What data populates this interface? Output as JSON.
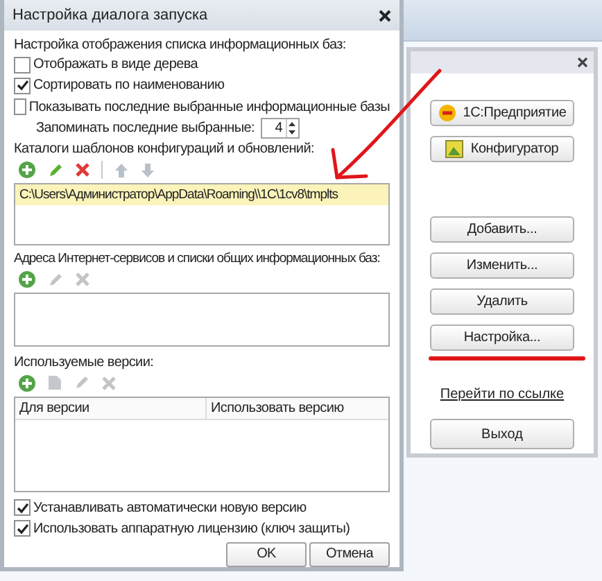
{
  "dialog": {
    "title": "Настройка диалога запуска",
    "display_heading": "Настройка отображения списка информационных баз:",
    "options": [
      {
        "label": "Отображать в виде дерева",
        "checked": false
      },
      {
        "label": "Сортировать по наименованию",
        "checked": true
      },
      {
        "label": "Показывать последние выбранные информационные базы",
        "checked": false
      }
    ],
    "remember": {
      "label": "Запоминать последние выбранные:",
      "value": "4"
    },
    "templates": {
      "heading": "Каталоги шаблонов конфигураций и обновлений:",
      "toolbar": [
        {
          "kind": "add",
          "disabled": false
        },
        {
          "kind": "edit",
          "disabled": false
        },
        {
          "kind": "delete",
          "disabled": false
        },
        {
          "kind": "up",
          "disabled": true
        },
        {
          "kind": "down",
          "disabled": true
        }
      ],
      "items": [
        {
          "text": "C:\\Users\\Администратор\\AppData\\Roaming\\\\1C\\1cv8\\tmplts",
          "selected": true
        }
      ]
    },
    "services": {
      "heading": "Адреса Интернет-сервисов и списки общих информационных баз:",
      "toolbar": [
        {
          "kind": "add",
          "disabled": false
        },
        {
          "kind": "edit",
          "disabled": true
        },
        {
          "kind": "delete",
          "disabled": true
        }
      ]
    },
    "versions": {
      "heading": "Используемые версии:",
      "toolbar": [
        {
          "kind": "add",
          "disabled": false
        },
        {
          "kind": "copy",
          "disabled": true
        },
        {
          "kind": "edit",
          "disabled": true
        },
        {
          "kind": "delete",
          "disabled": true
        }
      ],
      "columns": [
        "Для версии",
        "Использовать версию"
      ]
    },
    "bottom_options": [
      {
        "label": "Устанавливать автоматически новую версию",
        "checked": true
      },
      {
        "label": "Использовать аппаратную лицензию (ключ защиты)",
        "checked": true
      }
    ],
    "buttons": [
      "OK",
      "Отмена"
    ]
  },
  "launcher": {
    "buttons": [
      {
        "label": "1С:Предприятие",
        "kind": "enterprise"
      },
      {
        "label": "Конфигуратор",
        "kind": "designer"
      },
      {
        "label": "Добавить...",
        "kind": "plain"
      },
      {
        "label": "Изменить...",
        "kind": "plain"
      },
      {
        "label": "Удалить",
        "kind": "plain"
      },
      {
        "label": "Настройка...",
        "kind": "plain"
      }
    ],
    "link": "Перейти по ссылке",
    "exit": "Выход"
  }
}
